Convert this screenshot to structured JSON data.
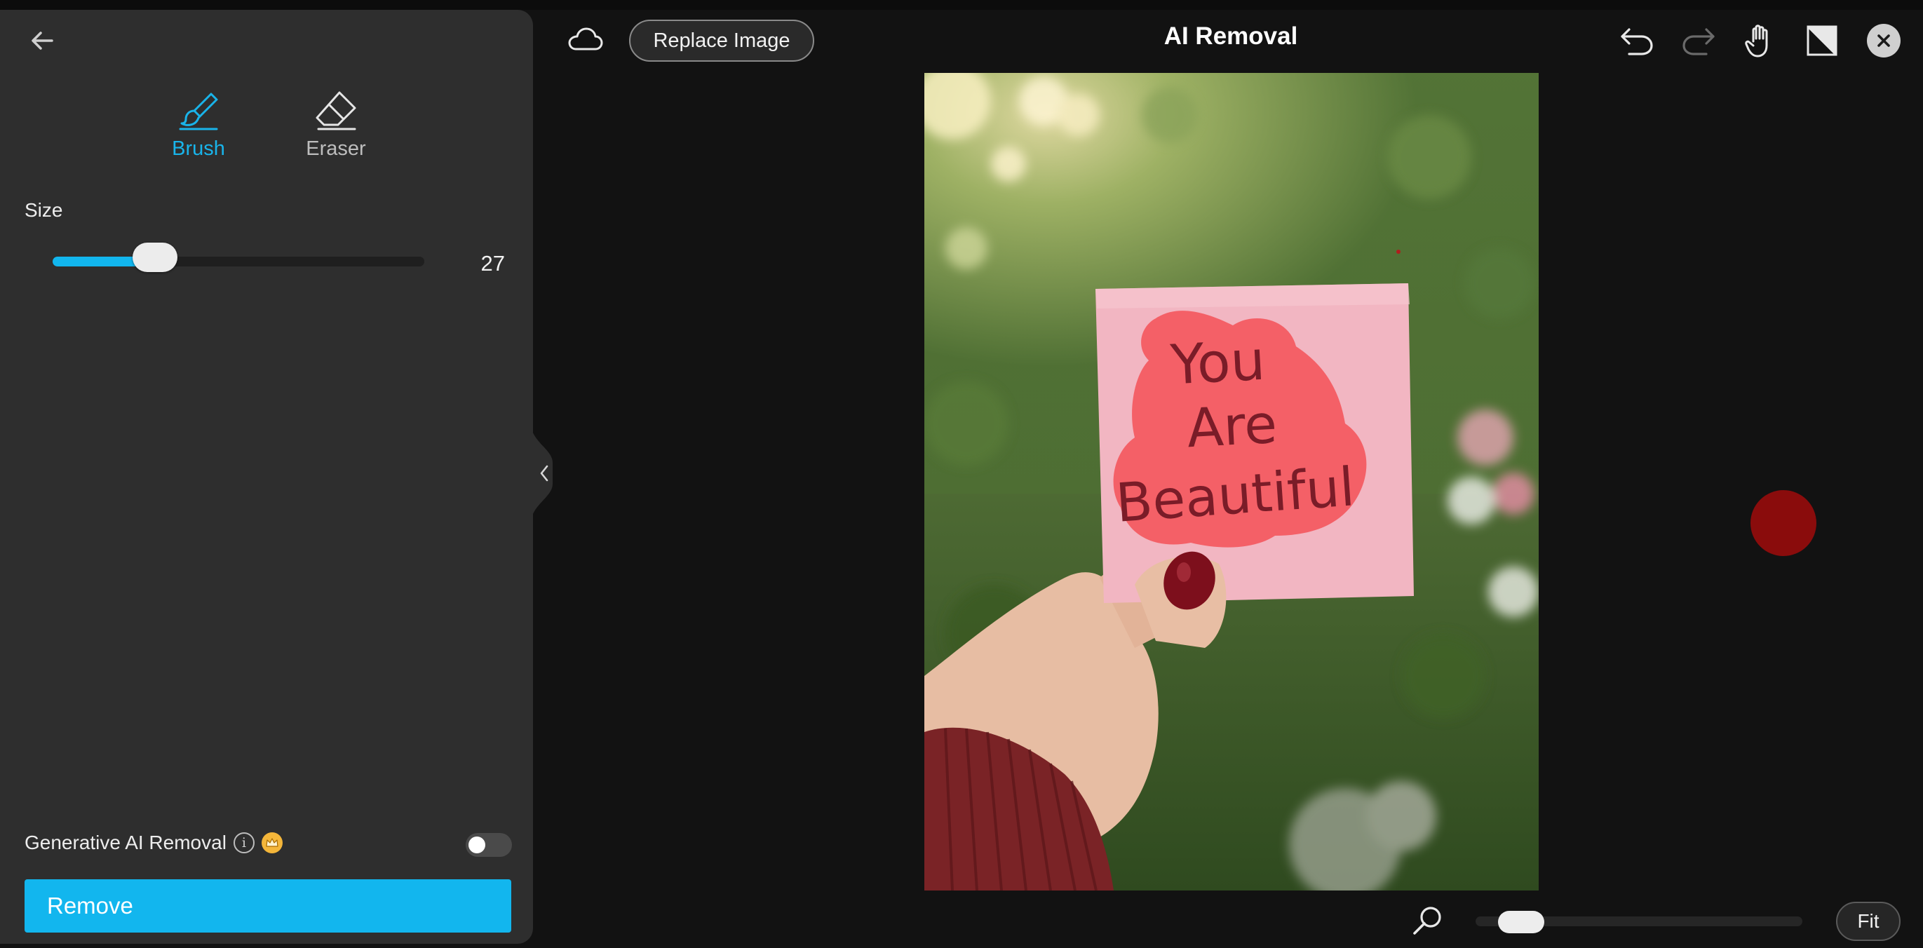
{
  "panel": {
    "tools": [
      {
        "label": "Brush",
        "icon": "brush-icon",
        "active": true
      },
      {
        "label": "Eraser",
        "icon": "eraser-icon",
        "active": false
      }
    ],
    "size_label": "Size",
    "size_value": "27",
    "size_fraction": 0.26,
    "generative_label": "Generative AI Removal",
    "generative_enabled": false,
    "remove_label": "Remove"
  },
  "toolbar": {
    "replace_label": "Replace Image",
    "title": "AI Removal"
  },
  "image": {
    "note_lines": [
      "You",
      "Are",
      "Beautiful"
    ]
  },
  "bottom": {
    "fit_label": "Fit",
    "zoom_fraction": 0.08
  },
  "colors": {
    "accent": "#12b6ee",
    "brush_cursor": "#8a0c0c"
  }
}
